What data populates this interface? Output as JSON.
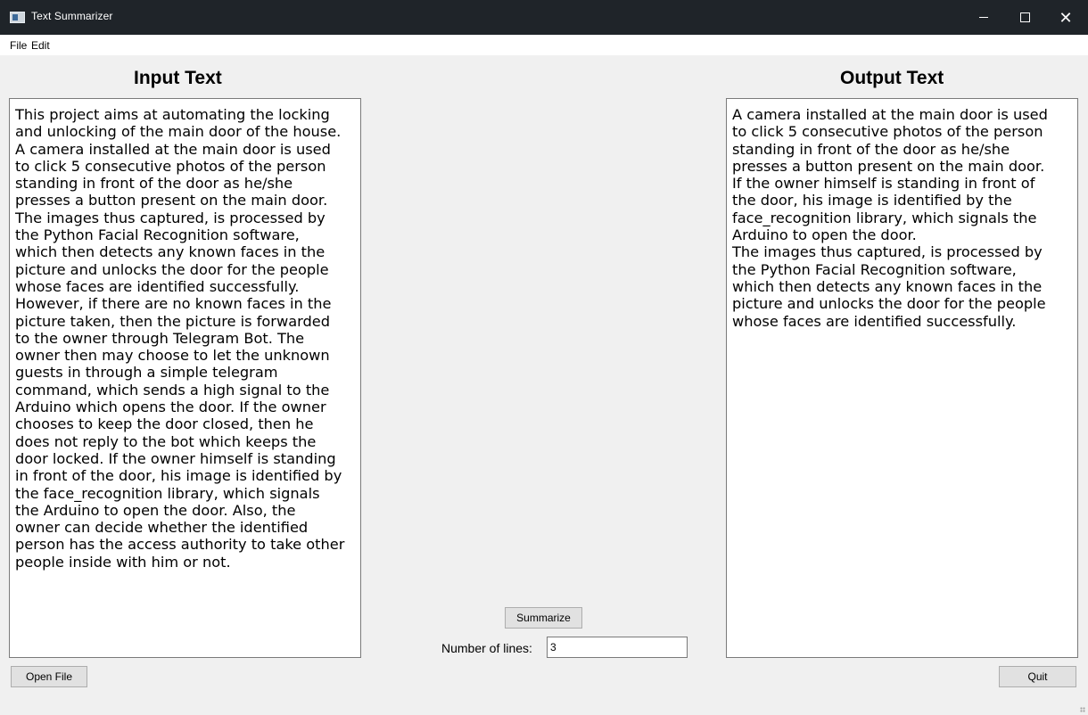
{
  "window": {
    "title": "Text Summarizer",
    "minimize_icon": "minimize-icon",
    "maximize_icon": "maximize-icon",
    "close_icon": "close-icon",
    "close_glyph": "✕"
  },
  "menu": {
    "items": [
      "File",
      "Edit"
    ]
  },
  "input_panel": {
    "heading": "Input Text",
    "text": "This project aims at automating the locking\nand unlocking of the main door of the house.\nA camera installed at the main door is used\nto click 5 consecutive photos of the person\nstanding in front of the door as he/she\npresses a button present on the main door.\nThe images thus captured, is processed by\nthe Python Facial Recognition software,\nwhich then detects any known faces in the\npicture and unlocks the door for the people\nwhose faces are identified successfully.\nHowever, if there are no known faces in the\npicture taken, then the picture is forwarded\nto the owner through Telegram Bot. The\nowner then may choose to let the unknown\nguests in through a simple telegram\ncommand, which sends a high signal to the\nArduino which opens the door. If the owner\nchooses to keep the door closed, then he\ndoes not reply to the bot which keeps the\ndoor locked. If the owner himself is standing\nin front of the door, his image is identified by\nthe face_recognition library, which signals\nthe Arduino to open the door. Also, the\nowner can decide whether the identified\nperson has the access authority to take other\npeople inside with him or not."
  },
  "output_panel": {
    "heading": "Output Text",
    "text": "A camera installed at the main door is used\nto click 5 consecutive photos of the person\nstanding in front of the door as he/she\npresses a button present on the main door.\nIf the owner himself is standing in front of\nthe door, his image is identified by the\nface_recognition library, which signals the\nArduino to open the door.\nThe images thus captured, is processed by\nthe Python Facial Recognition software,\nwhich then detects any known faces in the\npicture and unlocks the door for the people\nwhose faces are identified successfully."
  },
  "controls": {
    "summarize_label": "Summarize",
    "lines_label": "Number of lines:",
    "lines_value": "3",
    "open_file_label": "Open File",
    "quit_label": "Quit"
  }
}
